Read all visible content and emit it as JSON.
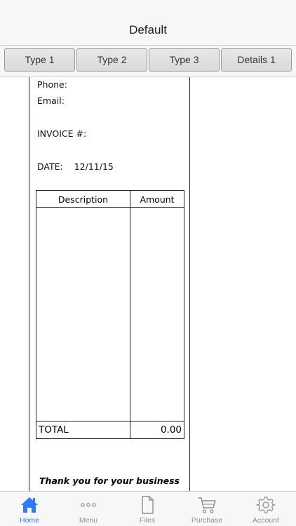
{
  "nav": {
    "title": "Default"
  },
  "tabs": [
    {
      "label": "Type 1"
    },
    {
      "label": "Type 2"
    },
    {
      "label": "Type 3"
    },
    {
      "label": "Details 1"
    }
  ],
  "invoice": {
    "phone_label": "Phone:",
    "email_label": "Email:",
    "invoice_label": "INVOICE #:",
    "date_label": "DATE:",
    "date_value": "12/11/15",
    "table": {
      "headers": [
        "Description",
        "Amount"
      ],
      "total_label": "TOTAL",
      "total_value": "0.00"
    },
    "thanks": "Thank you for your business"
  },
  "bottom_tabs": [
    {
      "label": "Home",
      "icon": "home-icon",
      "active": true
    },
    {
      "label": "Menu",
      "icon": "more-dots-icon"
    },
    {
      "label": "Files",
      "icon": "file-icon"
    },
    {
      "label": "Purchase",
      "icon": "cart-icon"
    },
    {
      "label": "Account",
      "icon": "gear-icon"
    }
  ],
  "colors": {
    "accent": "#2f7cf6",
    "inactive": "#8e8e93",
    "bar_background": "#f7f7f8"
  }
}
